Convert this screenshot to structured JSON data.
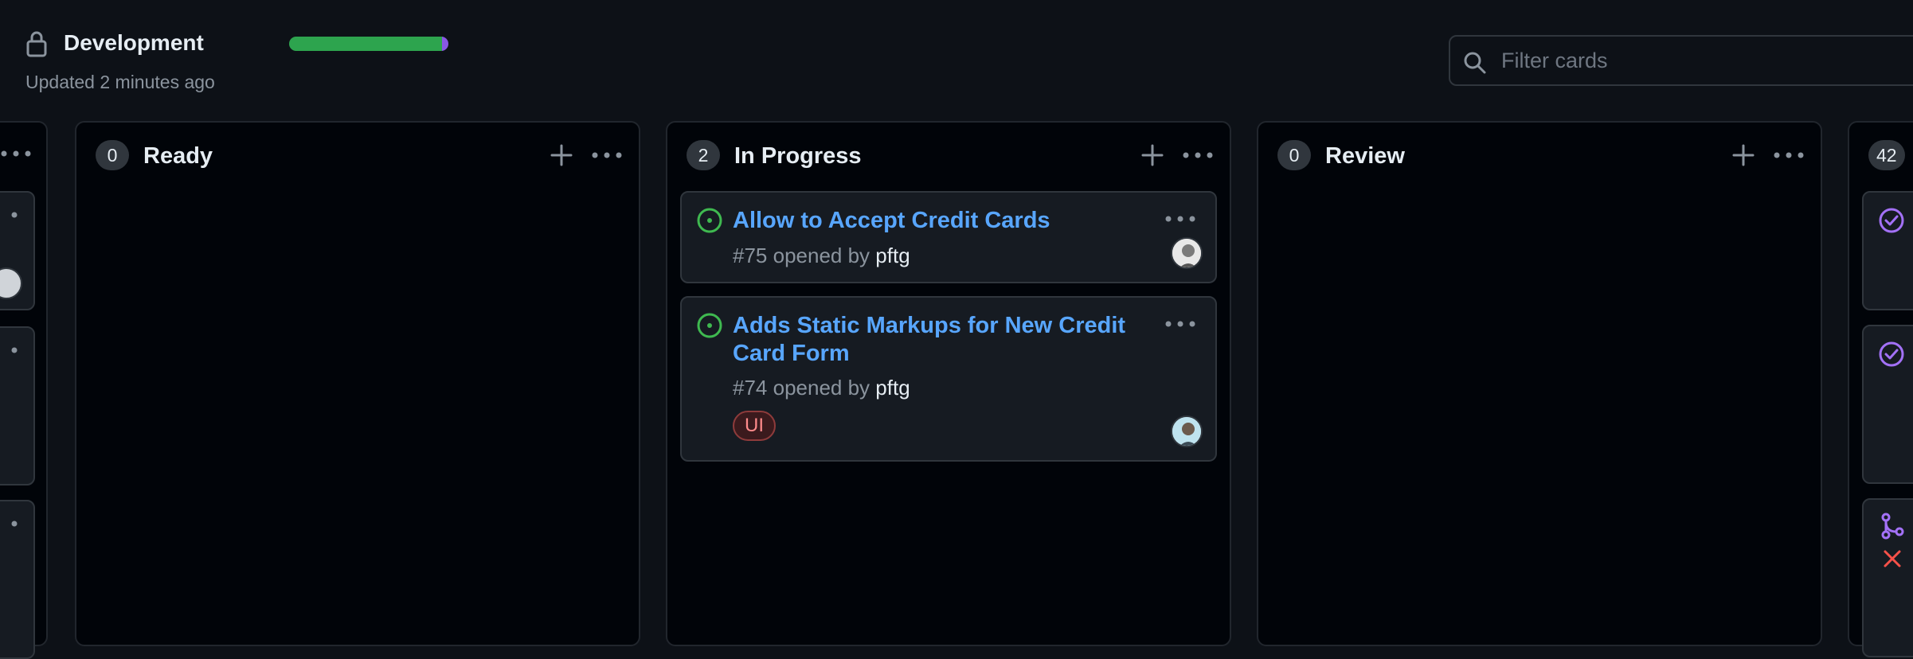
{
  "project": {
    "title": "Development",
    "updated": "Updated 2 minutes ago",
    "progress": {
      "done_fraction": 0.96,
      "in_progress_fraction": 0.04
    },
    "colors": {
      "done": "#2da44e",
      "in_progress": "#8957e5",
      "accent": "#f78166"
    }
  },
  "filter": {
    "placeholder": "Filter cards",
    "value": ""
  },
  "columns": [
    {
      "name": "Ready",
      "count": "0"
    },
    {
      "name": "In Progress",
      "count": "2"
    },
    {
      "name": "Review",
      "count": "0"
    },
    {
      "name": "",
      "count": "42"
    }
  ],
  "cards": [
    {
      "title": "Allow to Accept Credit Cards",
      "meta_prefix": "#75 opened by ",
      "author": "pftg",
      "status_icon": "issue-opened-icon"
    },
    {
      "title": "Adds Static Markups for New Credit Card Form",
      "meta_prefix": "#74 opened by ",
      "author": "pftg",
      "label": "UI",
      "status_icon": "issue-opened-icon"
    }
  ]
}
